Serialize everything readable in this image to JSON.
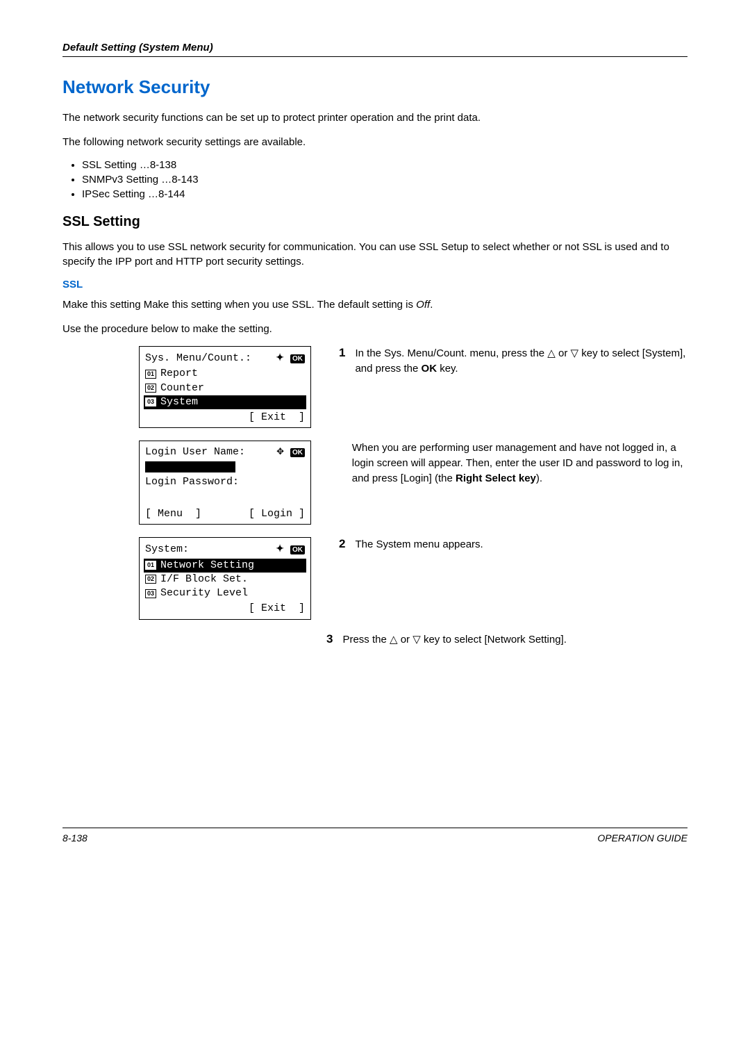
{
  "header": {
    "breadcrumb": "Default Setting (System Menu)"
  },
  "title": "Network Security",
  "intro1": "The network security functions can be set up to protect printer operation and the print data.",
  "intro2": "The following network security settings are available.",
  "bullets": [
    "SSL Setting …8-138",
    "SNMPv3 Setting …8-143",
    "IPSec Setting …8-144"
  ],
  "ssl_heading": "SSL Setting",
  "ssl_intro": "This allows you to use SSL network security for communication. You can use SSL Setup to select whether or not SSL is used and to specify the IPP port and HTTP port security settings.",
  "ssl_sub": "SSL",
  "ssl_desc_prefix": "Make this setting Make this setting when you use SSL. The default setting is ",
  "ssl_desc_italic": "Off",
  "ssl_desc_suffix": ".",
  "ssl_proc": "Use the procedure below to make the setting.",
  "lcd1": {
    "title": "Sys. Menu/Count.:",
    "items": [
      "Report",
      "Counter",
      "System"
    ],
    "button": "Exit"
  },
  "lcd2": {
    "line1": "Login User Name:",
    "line2": "Login Password:",
    "btn_left": "Menu",
    "btn_right": "Login"
  },
  "lcd3": {
    "title": "System:",
    "items": [
      "Network Setting",
      "I/F Block Set.",
      "Security Level"
    ],
    "button": "Exit"
  },
  "step1": {
    "num": "1",
    "text_a": "In the Sys. Menu/Count. menu, press the ",
    "text_b": " or ",
    "text_c": " key to select [System], and press the ",
    "text_d": "OK",
    "text_e": " key."
  },
  "step1b": {
    "text_a": "When you are performing user management and have not logged in, a login screen will appear. Then, enter the user ID and password to log in, and press [Login] (the ",
    "text_b": "Right Select key",
    "text_c": ")."
  },
  "step2": {
    "num": "2",
    "text": "The System menu appears."
  },
  "step3": {
    "num": "3",
    "text_a": "Press the ",
    "text_b": " or ",
    "text_c": " key to select [Network Setting]."
  },
  "footer": {
    "left": "8-138",
    "right": "OPERATION GUIDE"
  }
}
